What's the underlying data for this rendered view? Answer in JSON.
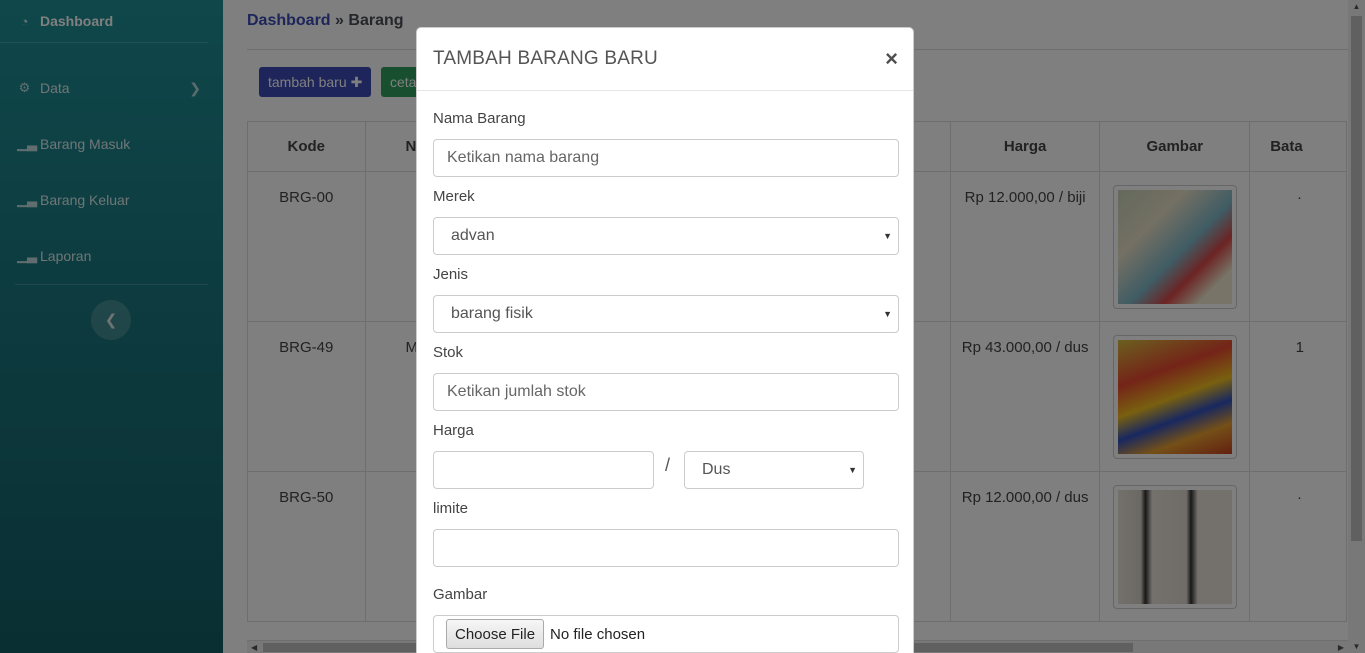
{
  "sidebar": {
    "dashboard": "Dashboard",
    "items": [
      {
        "label": "Data",
        "icon": "gear-icon"
      },
      {
        "label": "Barang Masuk",
        "icon": "bar-chart-icon"
      },
      {
        "label": "Barang Keluar",
        "icon": "bar-chart-icon"
      },
      {
        "label": "Laporan",
        "icon": "bar-chart-icon"
      }
    ]
  },
  "breadcrumb": {
    "home": "Dashboard",
    "separator": "»",
    "current": "Barang"
  },
  "toolbar": {
    "add_label": "tambah baru",
    "print_label": "ceta"
  },
  "table": {
    "headers": [
      "Kode",
      "N",
      "Harga",
      "Gambar",
      "Bata"
    ],
    "rows": [
      {
        "kode": "BRG-00",
        "nama": "",
        "harga": "Rp 12.000,00 / biji",
        "batas": "·"
      },
      {
        "kode": "BRG-49",
        "nama": "M",
        "harga": "Rp 43.000,00 / dus",
        "batas": "1"
      },
      {
        "kode": "BRG-50",
        "nama": "",
        "harga": "Rp 12.000,00 / dus",
        "batas": "·"
      }
    ]
  },
  "modal": {
    "title": "TAMBAH BARANG BARU",
    "close": "×",
    "nama_label": "Nama Barang",
    "nama_placeholder": "Ketikan nama barang",
    "merek_label": "Merek",
    "merek_value": "advan",
    "jenis_label": "Jenis",
    "jenis_value": "barang fisik",
    "stok_label": "Stok",
    "stok_placeholder": "Ketikan jumlah stok",
    "harga_label": "Harga",
    "harga_value": "",
    "slash": "/",
    "satuan_value": "Dus",
    "limite_label": "limite",
    "limite_value": "",
    "gambar_label": "Gambar",
    "file_button": "Choose File",
    "file_status": "No file chosen"
  },
  "colors": {
    "sidebar": "#1a777f",
    "primary": "#3b4bb4",
    "success": "#2e9e5e"
  }
}
